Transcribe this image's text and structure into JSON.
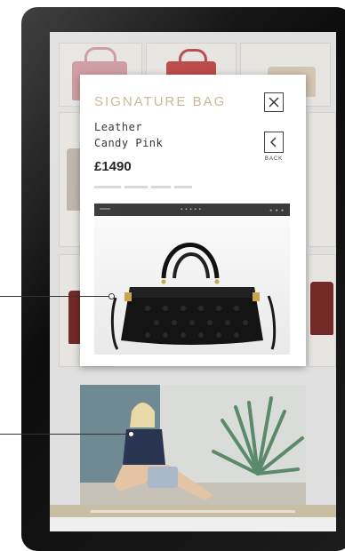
{
  "product": {
    "title": "SIGNATURE BAG",
    "material": "Leather",
    "color_name": "Candy Pink",
    "price": "£1490"
  },
  "controls": {
    "close_icon": "close-icon",
    "back_icon": "chevron-left-icon",
    "back_label": "BACK"
  },
  "colors": {
    "title": "#cdb691",
    "device_frame": "#111111",
    "banner": "#c9bda4"
  }
}
